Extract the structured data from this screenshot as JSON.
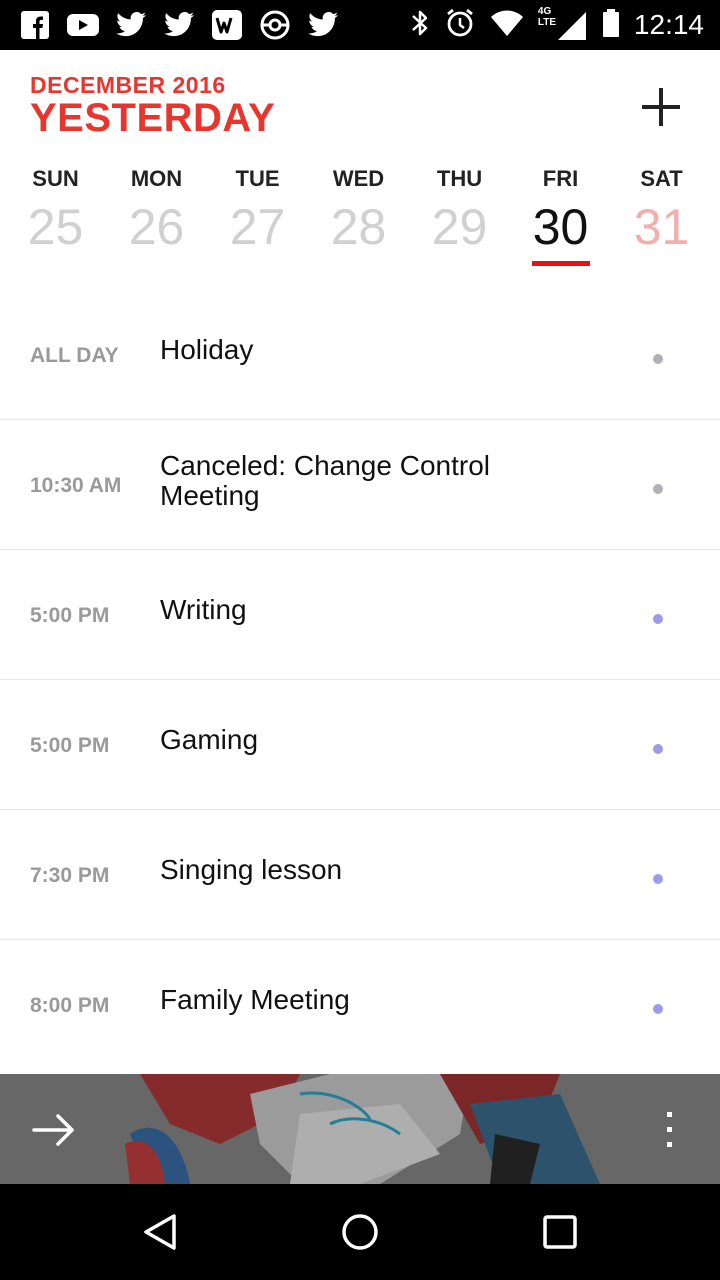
{
  "status_bar": {
    "time": "12:14",
    "network": "4G LTE",
    "notification_icons": [
      "facebook-icon",
      "youtube-icon",
      "twitter-icon",
      "twitter-icon",
      "wordpress-icon",
      "pokeball-icon",
      "twitter-icon"
    ],
    "system_icons": [
      "bluetooth-icon",
      "alarm-icon",
      "wifi-icon",
      "signal-icon",
      "battery-icon"
    ]
  },
  "header": {
    "month_label": "DECEMBER 2016",
    "title": "YESTERDAY",
    "add_icon": "plus-icon"
  },
  "week": [
    {
      "name": "SUN",
      "date": "25"
    },
    {
      "name": "MON",
      "date": "26"
    },
    {
      "name": "TUE",
      "date": "27"
    },
    {
      "name": "WED",
      "date": "28"
    },
    {
      "name": "THU",
      "date": "29"
    },
    {
      "name": "FRI",
      "date": "30"
    },
    {
      "name": "SAT",
      "date": "31"
    }
  ],
  "selected_day": "FRI",
  "events": [
    {
      "time": "ALL DAY",
      "title": "Holiday",
      "dot_color": "#b0b0b8"
    },
    {
      "time": "10:30 AM",
      "title": "Canceled: Change Control Meeting",
      "dot_color": "#b0b0b8"
    },
    {
      "time": "5:00 PM",
      "title": "Writing",
      "dot_color": "#9d9be8"
    },
    {
      "time": "5:00 PM",
      "title": "Gaming",
      "dot_color": "#9d9be8"
    },
    {
      "time": "7:30 PM",
      "title": "Singing lesson",
      "dot_color": "#9d9be8"
    },
    {
      "time": "8:00 PM",
      "title": "Family Meeting",
      "dot_color": "#9d9be8"
    }
  ],
  "bottom_bar": {
    "next_icon": "arrow-right-icon",
    "menu_icon": "more-vert-icon"
  },
  "nav_bar": {
    "icons": [
      "back-icon",
      "home-icon",
      "recents-icon"
    ]
  },
  "colors": {
    "accent": "#e8362e",
    "selected_underline": "#e01515",
    "weekend_date": "#f2b0ad"
  }
}
